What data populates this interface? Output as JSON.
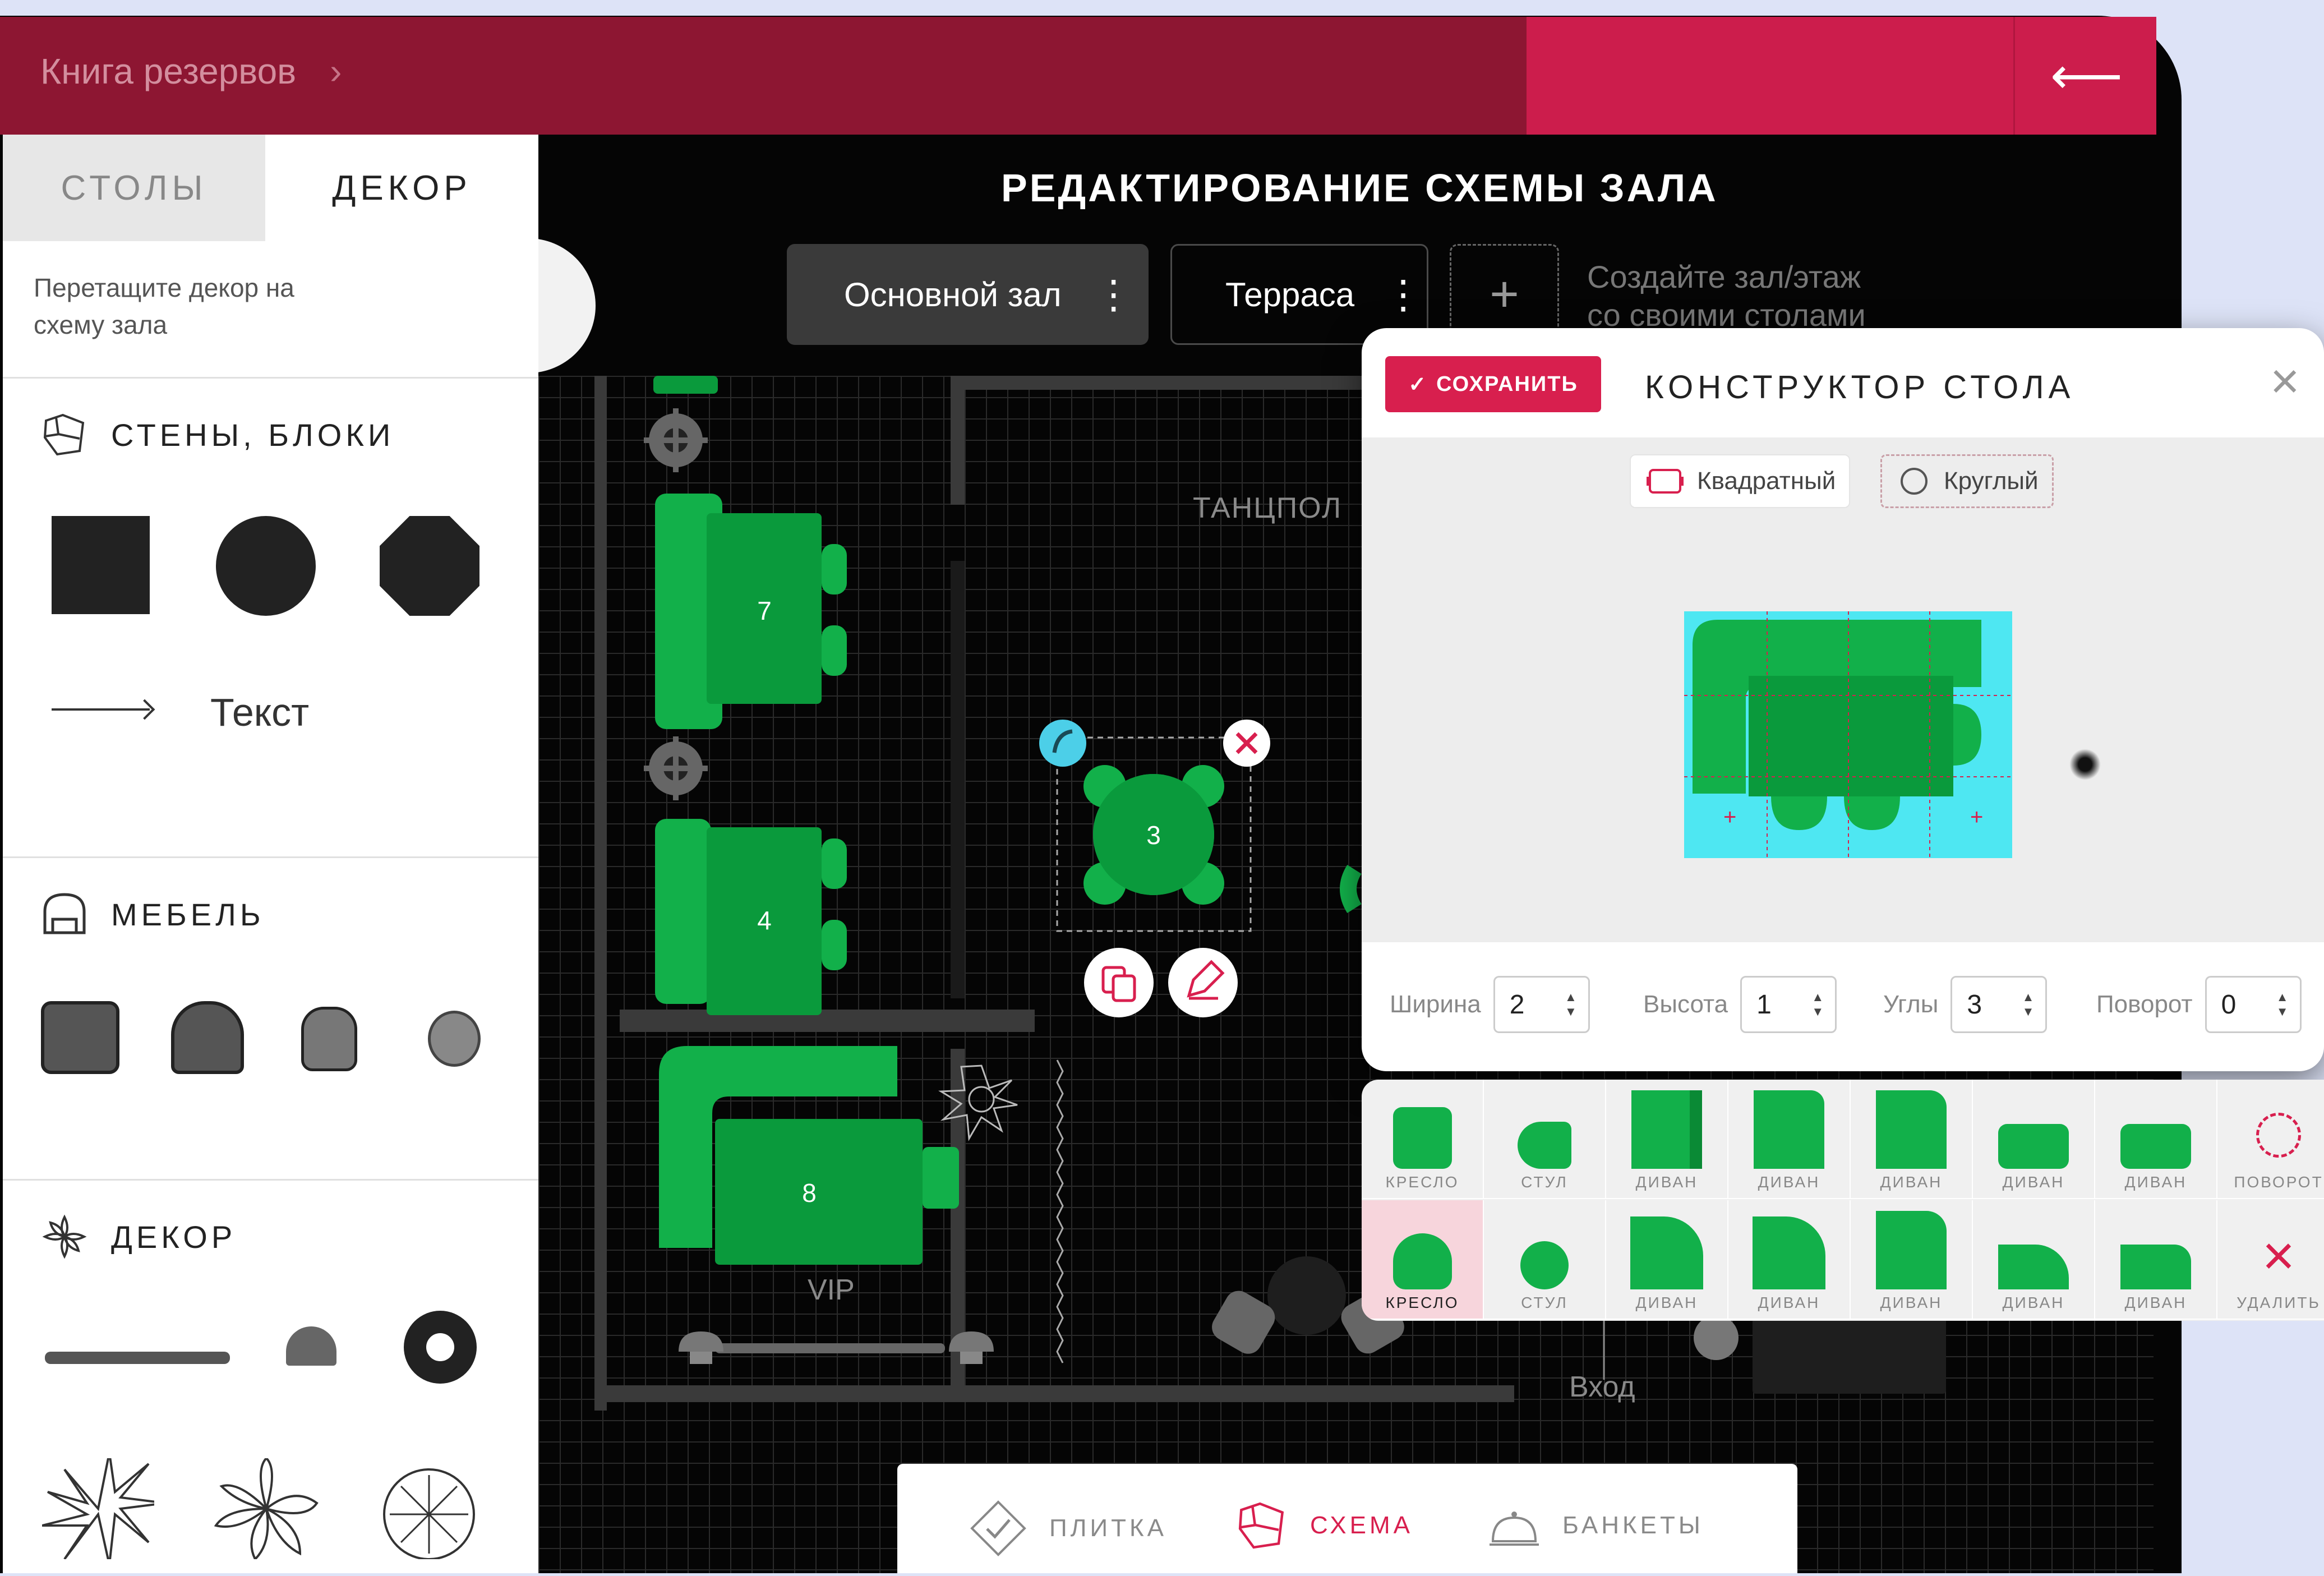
{
  "header": {
    "breadcrumb": "Книга резервов",
    "back_icon": "arrow-left-icon"
  },
  "sidebar": {
    "tabs": [
      {
        "label": "СТОЛЫ"
      },
      {
        "label": "ДЕКОР"
      }
    ],
    "hint": "Перетащите декор на схему зала",
    "sections": {
      "walls": {
        "title": "СТЕНЫ, БЛОКИ",
        "text_item": "Текст"
      },
      "furniture": {
        "title": "МЕБЕЛЬ"
      },
      "decor": {
        "title": "ДЕКОР"
      }
    }
  },
  "main": {
    "title": "РЕДАКТИРОВАНИЕ СХЕМЫ ЗАЛА",
    "halls": [
      {
        "label": "Основной зал"
      },
      {
        "label": "Терраса"
      }
    ],
    "create_hint_line1": "Создайте зал/этаж",
    "create_hint_line2": "со своими столами"
  },
  "floor": {
    "zone_dance": "ТАНЦПОЛ",
    "zone_vip": "VIP",
    "entrance": "Вход",
    "tables": [
      {
        "num": "7"
      },
      {
        "num": "4"
      },
      {
        "num": "3"
      },
      {
        "num": "8"
      }
    ]
  },
  "modal": {
    "save_label": "СОХРАНИТЬ",
    "title": "КОНСТРУКТОР СТОЛА",
    "shape_square": "Квадратный",
    "shape_round": "Круглый",
    "params": [
      {
        "label": "Ширина",
        "value": "2"
      },
      {
        "label": "Высота",
        "value": "1"
      },
      {
        "label": "Углы",
        "value": "3"
      },
      {
        "label": "Поворот",
        "value": "0"
      }
    ]
  },
  "palette": {
    "row1": [
      "КРЕСЛО",
      "СТУЛ",
      "ДИВАН",
      "ДИВАН",
      "ДИВАН",
      "ДИВАН",
      "ДИВАН",
      "ПОВОРОТ"
    ],
    "row2": [
      "КРЕСЛО",
      "СТУЛ",
      "ДИВАН",
      "ДИВАН",
      "ДИВАН",
      "ДИВАН",
      "ДИВАН",
      "УДАЛИТЬ"
    ]
  },
  "bottom_nav": [
    {
      "label": "ПЛИТКА"
    },
    {
      "label": "СХЕМА"
    },
    {
      "label": "БАНКЕТЫ"
    }
  ],
  "colors": {
    "accent": "#d81f4e",
    "header": "#8d1632",
    "table_green": "#0a9a3c",
    "selection": "#4ccfe8"
  }
}
